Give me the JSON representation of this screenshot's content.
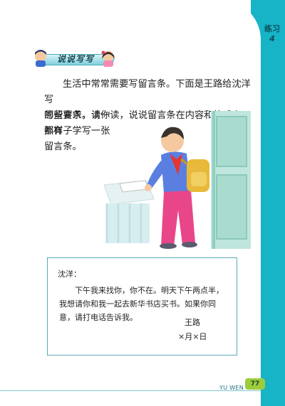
{
  "exercise": {
    "label": "练习",
    "number": "4"
  },
  "section": {
    "title": "说说写写"
  },
  "instructions": {
    "line1": "生活中常常需要写留言条。下面是王路给沈洋写",
    "line2": "的留言条，读一读，说说留言条在内容和格式上都有",
    "line3": "哪些要求。请你",
    "line4": "照样子学写一张",
    "line5": "留言条。"
  },
  "note": {
    "greeting": "沈洋：",
    "body_line1": "下午我来找你，你不在。明天下午两点半，",
    "body_line2": "我想请你和我一起去新华书店买书。如果你同",
    "body_line3": "意，请打电话告诉我。",
    "signature": "王路",
    "date": "×月×日"
  },
  "footer": {
    "subject": "YU WEN",
    "page": "77"
  },
  "colors": {
    "band": "#17b3c7",
    "note_border": "#5aa9b5",
    "page_box": "#9ccc3c"
  }
}
